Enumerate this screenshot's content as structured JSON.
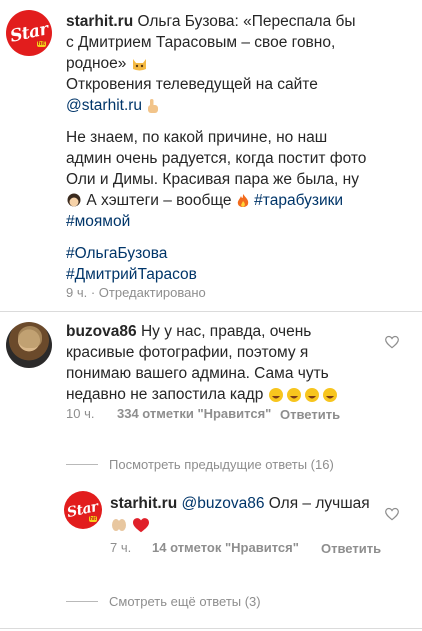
{
  "caption": {
    "author": "starhit.ru",
    "line1_rest": "Ольга Бузова: «Переспала бы",
    "line2": "с Дмитрием Тарасовым – свое говно,",
    "line3": "родное»",
    "line4": "Откровения телеведущей на сайте",
    "line5_link": "@starhit.ru",
    "line7": "Не знаем, по какой причине, но наш",
    "line8": "админ очень радуется, когда постит фото",
    "line9": "Оли и Димы. Красивая пара же была, ну",
    "line10_a": "А хэштеги – вообще",
    "line10_tag": "#тарабузики",
    "line11_tag": "#моямой",
    "tag1": "#ОльгаБузова",
    "tag2": "#ДмитрийТарасов",
    "time": "9 ч. · Отредактировано"
  },
  "comment": {
    "author": "buzova86",
    "line1_rest": "Ну у нас, правда, очень",
    "line2": "красивые фотографии, поэтому я",
    "line3": "понимаю вашего админа. Сама чуть",
    "line4": "недавно не запостила кадр",
    "time": "10 ч.",
    "likes": "334 отметки \"Нравится\"",
    "reply": "Ответить"
  },
  "previous_replies": "Посмотреть предыдущие ответы (16)",
  "reply": {
    "author": "starhit.ru",
    "mention": "@buzova86",
    "text": "Оля – лучшая",
    "time": "7 ч.",
    "likes": "14 отметок \"Нравится\"",
    "reply": "Ответить"
  },
  "more_replies": "Смотреть ещё ответы (3)",
  "logo": {
    "word": "Star",
    "badge": "hit"
  },
  "colors": {
    "logo_red": "#e21d1d",
    "link": "#003569",
    "meta_gray": "#8e8e8e"
  },
  "icons": [
    "heart-outline-icon"
  ]
}
